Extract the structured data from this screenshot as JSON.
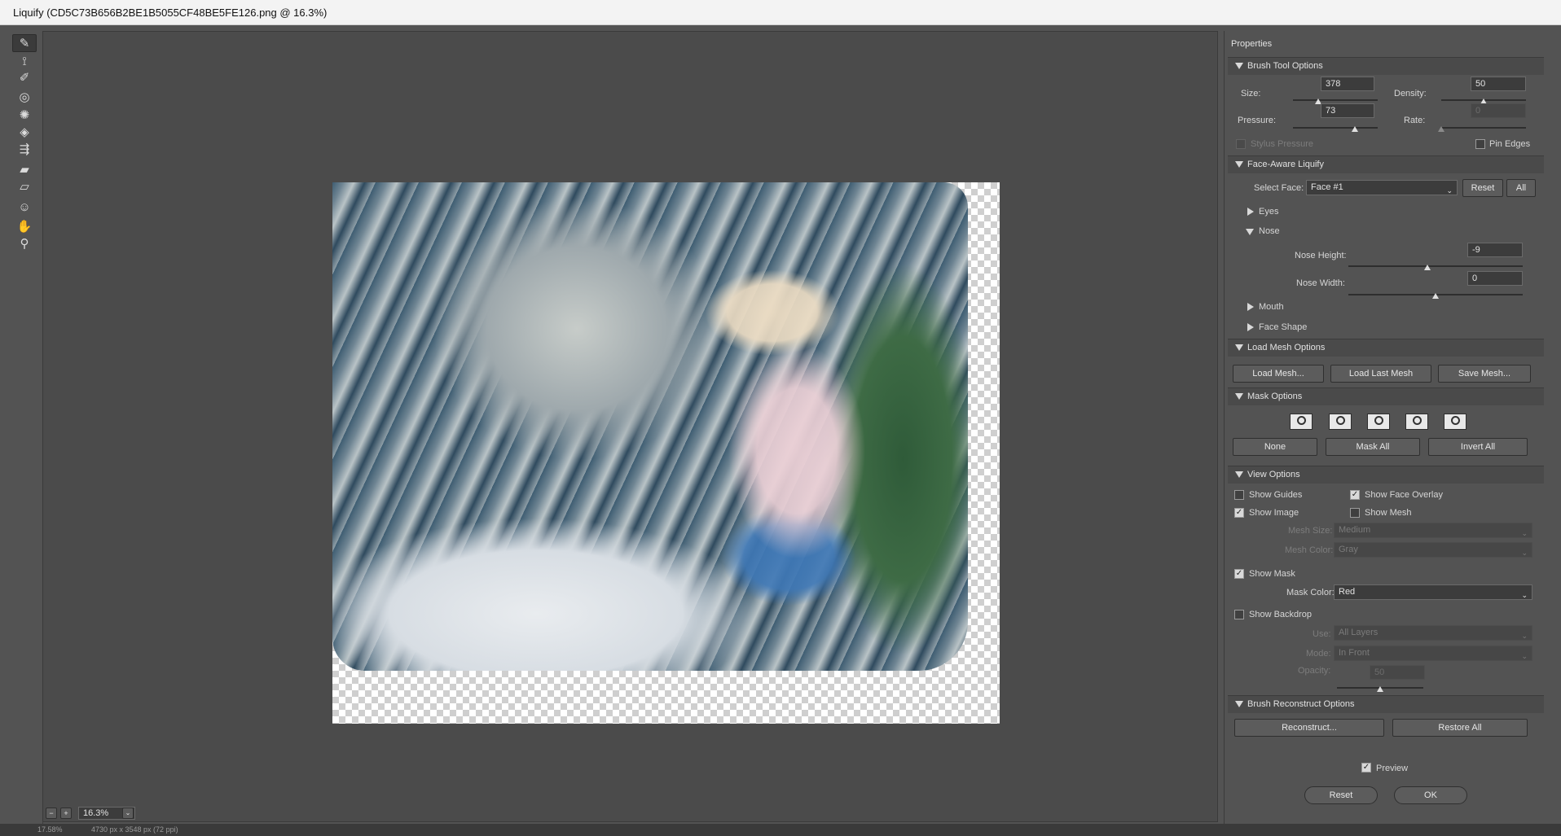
{
  "window": {
    "title": "Liquify (CD5C73B656B2BE1B5055CF48BE5FE126.png @ 16.3%)"
  },
  "tools": [
    {
      "name": "forward-warp-tool-icon",
      "glyph": "✎"
    },
    {
      "name": "reconstruct-tool-icon",
      "glyph": "⟟"
    },
    {
      "name": "smooth-tool-icon",
      "glyph": "✐"
    },
    {
      "name": "twirl-tool-icon",
      "glyph": "◎"
    },
    {
      "name": "pucker-tool-icon",
      "glyph": "✺"
    },
    {
      "name": "bloat-tool-icon",
      "glyph": "◈"
    },
    {
      "name": "push-left-tool-icon",
      "glyph": "⇶"
    },
    {
      "name": "freeze-mask-tool-icon",
      "glyph": "▰"
    },
    {
      "name": "thaw-mask-tool-icon",
      "glyph": "▱"
    },
    {
      "name": "face-tool-icon",
      "glyph": "☺"
    },
    {
      "name": "hand-tool-icon",
      "glyph": "✋"
    },
    {
      "name": "zoom-tool-icon",
      "glyph": "⚲"
    }
  ],
  "properties": {
    "title": "Properties",
    "brush_tool_options": {
      "header": "Brush Tool Options",
      "size_label": "Size:",
      "size": "378",
      "size_fraction": 0.3,
      "density_label": "Density:",
      "density": "50",
      "density_fraction": 0.5,
      "pressure_label": "Pressure:",
      "pressure": "73",
      "pressure_fraction": 0.73,
      "rate_label": "Rate:",
      "rate": "0",
      "rate_fraction": 0.0,
      "stylus_pressure": "Stylus Pressure",
      "pin_edges": "Pin Edges"
    },
    "face_aware": {
      "header": "Face-Aware Liquify",
      "select_face_label": "Select Face:",
      "select_face": "Face #1",
      "reset": "Reset",
      "all": "All",
      "eyes": "Eyes",
      "nose": "Nose",
      "nose_height_label": "Nose Height:",
      "nose_height": "-9",
      "nose_height_fraction": 0.455,
      "nose_width_label": "Nose Width:",
      "nose_width": "0",
      "nose_width_fraction": 0.5,
      "mouth": "Mouth",
      "face_shape": "Face Shape"
    },
    "load_mesh": {
      "header": "Load Mesh Options",
      "load_mesh": "Load Mesh...",
      "load_last_mesh": "Load Last Mesh",
      "save_mesh": "Save Mesh..."
    },
    "mask_options": {
      "header": "Mask Options",
      "modes": [
        "replace-selection-icon",
        "add-to-selection-icon",
        "subtract-from-selection-icon",
        "intersect-with-selection-icon",
        "invert-selection-icon"
      ],
      "none": "None",
      "mask_all": "Mask All",
      "invert_all": "Invert All"
    },
    "view_options": {
      "header": "View Options",
      "show_guides": "Show Guides",
      "show_face_overlay": "Show Face Overlay",
      "show_image": "Show Image",
      "show_mesh": "Show Mesh",
      "mesh_size_label": "Mesh Size:",
      "mesh_size": "Medium",
      "mesh_color_label": "Mesh Color:",
      "mesh_color": "Gray",
      "show_mask": "Show Mask",
      "mask_color_label": "Mask Color:",
      "mask_color": "Red",
      "show_backdrop": "Show Backdrop",
      "use_label": "Use:",
      "use": "All Layers",
      "mode_label": "Mode:",
      "mode": "In Front",
      "opacity_label": "Opacity:",
      "opacity": "50",
      "opacity_fraction": 0.5
    },
    "brush_reconstruct": {
      "header": "Brush Reconstruct Options",
      "reconstruct": "Reconstruct...",
      "restore_all": "Restore All"
    },
    "preview": "Preview",
    "reset": "Reset",
    "ok": "OK"
  },
  "canvas": {
    "zoom": "16.3%"
  },
  "status": {
    "zoom": "17.58%",
    "dimensions": "4730 px x 3548 px (72 ppi)"
  },
  "colors": {
    "panel": "#535353",
    "canvas": "#4b4b4b",
    "title_bar": "#f3f3f3"
  }
}
